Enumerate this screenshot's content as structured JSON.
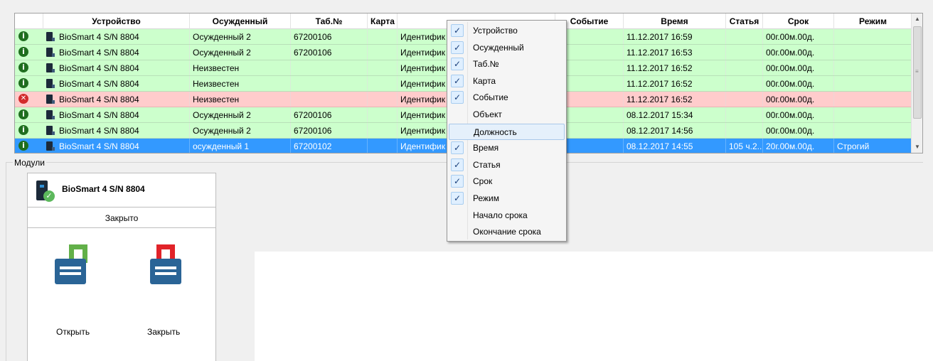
{
  "colors": {
    "row_ok": "#ccffcc",
    "row_error": "#ffcccc",
    "row_selected": "#3399ff",
    "lock_open_shackle": "#62b049",
    "lock_closed_shackle": "#e12329",
    "lock_body": "#2a6496"
  },
  "grid": {
    "columns": [
      "Устройство",
      "Осужденный",
      "Таб.№",
      "Карта",
      "",
      "Событие",
      "Время",
      "Статья",
      "Срок",
      "Режим"
    ],
    "rows": [
      {
        "status": "ok",
        "status_icon": "info-icon",
        "device": "BioSmart 4 S/N 8804",
        "convict": "Осужденный 2",
        "tab": "67200106",
        "card": "",
        "ident": "Идентифик",
        "event": "",
        "time": "11.12.2017 16:59",
        "article": "",
        "term": "00г.00м.00д.",
        "mode": ""
      },
      {
        "status": "ok",
        "status_icon": "info-icon",
        "device": "BioSmart 4 S/N 8804",
        "convict": "Осужденный 2",
        "tab": "67200106",
        "card": "",
        "ident": "Идентифик",
        "event": "",
        "time": "11.12.2017 16:53",
        "article": "",
        "term": "00г.00м.00д.",
        "mode": ""
      },
      {
        "status": "ok",
        "status_icon": "info-icon",
        "device": "BioSmart 4 S/N 8804",
        "convict": "Неизвестен",
        "tab": "",
        "card": "",
        "ident": "Идентифик",
        "event": "",
        "time": "11.12.2017 16:52",
        "article": "",
        "term": "00г.00м.00д.",
        "mode": ""
      },
      {
        "status": "ok",
        "status_icon": "info-icon",
        "device": "BioSmart 4 S/N 8804",
        "convict": "Неизвестен",
        "tab": "",
        "card": "",
        "ident": "Идентифик",
        "event": "",
        "time": "11.12.2017 16:52",
        "article": "",
        "term": "00г.00м.00д.",
        "mode": ""
      },
      {
        "status": "err",
        "status_icon": "error-icon",
        "device": "BioSmart 4 S/N 8804",
        "convict": "Неизвестен",
        "tab": "",
        "card": "",
        "ident": "Идентифик",
        "event": "",
        "time": "11.12.2017 16:52",
        "article": "",
        "term": "00г.00м.00д.",
        "mode": ""
      },
      {
        "status": "ok",
        "status_icon": "info-icon",
        "device": "BioSmart 4 S/N 8804",
        "convict": "Осужденный 2",
        "tab": "67200106",
        "card": "",
        "ident": "Идентифик",
        "event": "",
        "time": "08.12.2017 15:34",
        "article": "",
        "term": "00г.00м.00д.",
        "mode": ""
      },
      {
        "status": "ok",
        "status_icon": "info-icon",
        "device": "BioSmart 4 S/N 8804",
        "convict": "Осужденный 2",
        "tab": "67200106",
        "card": "",
        "ident": "Идентифик",
        "event": "",
        "time": "08.12.2017 14:56",
        "article": "",
        "term": "00г.00м.00д.",
        "mode": ""
      },
      {
        "status": "sel",
        "status_icon": "info-icon",
        "device": "BioSmart 4 S/N 8804",
        "convict": "осужденный 1",
        "tab": "67200102",
        "card": "",
        "ident": "Идентифик",
        "event": "",
        "time": "08.12.2017 14:55",
        "article": "105 ч.2...",
        "term": "20г.00м.00д.",
        "mode": "Строгий"
      }
    ]
  },
  "modules": {
    "title": "Модули",
    "card": {
      "name": "BioSmart 4 S/N 8804",
      "state": "Закрыто",
      "open_label": "Открыть",
      "close_label": "Закрыть"
    }
  },
  "context_menu": {
    "items": [
      {
        "label": "Устройство",
        "checked": true
      },
      {
        "label": "Осужденный",
        "checked": true
      },
      {
        "label": "Таб.№",
        "checked": true
      },
      {
        "label": "Карта",
        "checked": true
      },
      {
        "label": "Событие",
        "checked": true
      },
      {
        "label": "Объект",
        "checked": false
      },
      {
        "label": "Должность",
        "checked": false,
        "hover": true
      },
      {
        "label": "Время",
        "checked": true
      },
      {
        "label": "Статья",
        "checked": true
      },
      {
        "label": "Срок",
        "checked": true
      },
      {
        "label": "Режим",
        "checked": true
      },
      {
        "label": "Начало срока",
        "checked": false
      },
      {
        "label": "Окончание срока",
        "checked": false
      }
    ]
  }
}
